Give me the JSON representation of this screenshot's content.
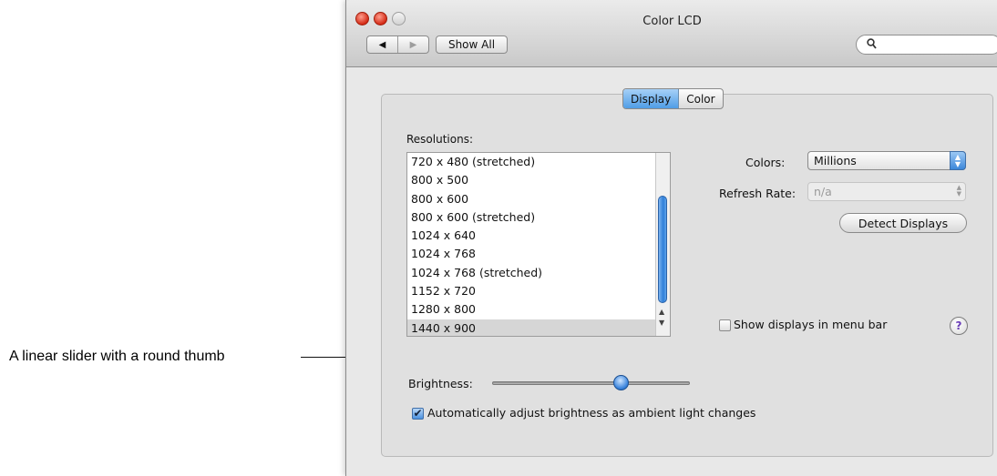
{
  "annotation": {
    "callout": "A linear slider with a round thumb"
  },
  "window": {
    "title": "Color LCD"
  },
  "toolbar": {
    "back_icon": "back-arrow-icon",
    "forward_icon": "forward-arrow-icon",
    "show_all": "Show All",
    "search_placeholder": ""
  },
  "tabs": [
    {
      "label": "Display",
      "selected": true
    },
    {
      "label": "Color",
      "selected": false
    }
  ],
  "display": {
    "resolutions_label": "Resolutions:",
    "resolutions": [
      "720 x 480 (stretched)",
      "800 x 500",
      "800 x 600",
      "800 x 600 (stretched)",
      "1024 x 640",
      "1024 x 768",
      "1024 x 768 (stretched)",
      "1152 x 720",
      "1280 x 800",
      "1440 x 900"
    ],
    "selected_resolution": "1440 x 900",
    "colors_label": "Colors:",
    "colors_value": "Millions",
    "refresh_label": "Refresh Rate:",
    "refresh_value": "n/a",
    "detect_button": "Detect Displays",
    "menu_bar_checkbox": {
      "label": "Show displays in menu bar",
      "checked": false
    },
    "help": "?",
    "brightness_label": "Brightness:",
    "brightness_level": 0.65,
    "auto_brightness": {
      "label": "Automatically adjust brightness as ambient light changes",
      "checked": true
    }
  },
  "colors": {
    "accent": "#3c85dd",
    "close": "#d42b16",
    "help": "#6a3db8"
  }
}
